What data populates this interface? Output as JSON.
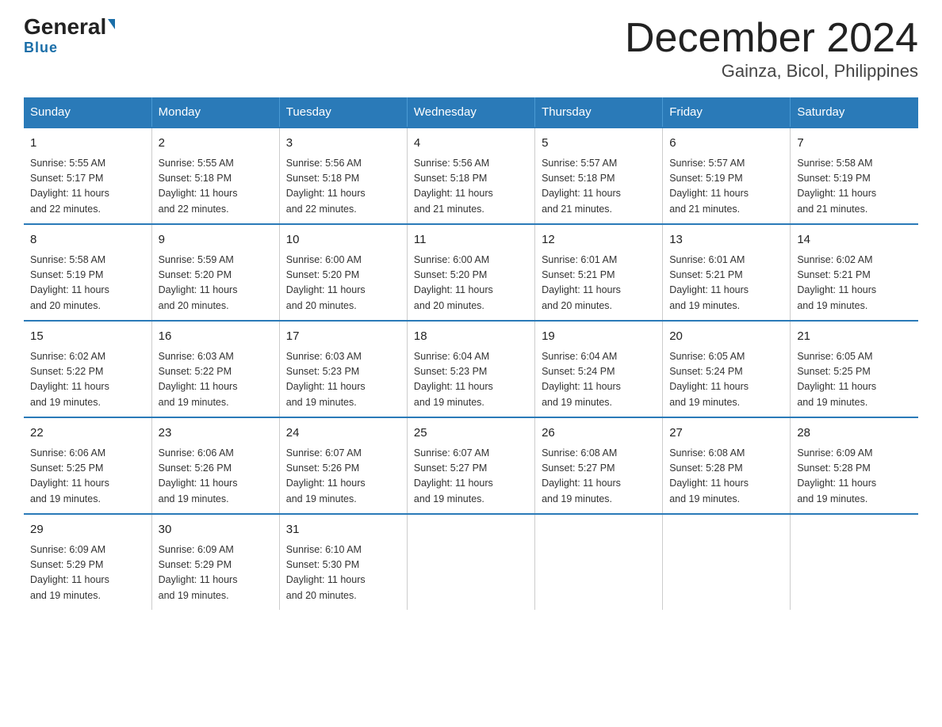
{
  "header": {
    "logo_general": "General",
    "logo_blue": "Blue",
    "title": "December 2024",
    "subtitle": "Gainza, Bicol, Philippines"
  },
  "days_of_week": [
    "Sunday",
    "Monday",
    "Tuesday",
    "Wednesday",
    "Thursday",
    "Friday",
    "Saturday"
  ],
  "weeks": [
    [
      {
        "day": "1",
        "sunrise": "5:55 AM",
        "sunset": "5:17 PM",
        "daylight": "11 hours and 22 minutes."
      },
      {
        "day": "2",
        "sunrise": "5:55 AM",
        "sunset": "5:18 PM",
        "daylight": "11 hours and 22 minutes."
      },
      {
        "day": "3",
        "sunrise": "5:56 AM",
        "sunset": "5:18 PM",
        "daylight": "11 hours and 22 minutes."
      },
      {
        "day": "4",
        "sunrise": "5:56 AM",
        "sunset": "5:18 PM",
        "daylight": "11 hours and 21 minutes."
      },
      {
        "day": "5",
        "sunrise": "5:57 AM",
        "sunset": "5:18 PM",
        "daylight": "11 hours and 21 minutes."
      },
      {
        "day": "6",
        "sunrise": "5:57 AM",
        "sunset": "5:19 PM",
        "daylight": "11 hours and 21 minutes."
      },
      {
        "day": "7",
        "sunrise": "5:58 AM",
        "sunset": "5:19 PM",
        "daylight": "11 hours and 21 minutes."
      }
    ],
    [
      {
        "day": "8",
        "sunrise": "5:58 AM",
        "sunset": "5:19 PM",
        "daylight": "11 hours and 20 minutes."
      },
      {
        "day": "9",
        "sunrise": "5:59 AM",
        "sunset": "5:20 PM",
        "daylight": "11 hours and 20 minutes."
      },
      {
        "day": "10",
        "sunrise": "6:00 AM",
        "sunset": "5:20 PM",
        "daylight": "11 hours and 20 minutes."
      },
      {
        "day": "11",
        "sunrise": "6:00 AM",
        "sunset": "5:20 PM",
        "daylight": "11 hours and 20 minutes."
      },
      {
        "day": "12",
        "sunrise": "6:01 AM",
        "sunset": "5:21 PM",
        "daylight": "11 hours and 20 minutes."
      },
      {
        "day": "13",
        "sunrise": "6:01 AM",
        "sunset": "5:21 PM",
        "daylight": "11 hours and 19 minutes."
      },
      {
        "day": "14",
        "sunrise": "6:02 AM",
        "sunset": "5:21 PM",
        "daylight": "11 hours and 19 minutes."
      }
    ],
    [
      {
        "day": "15",
        "sunrise": "6:02 AM",
        "sunset": "5:22 PM",
        "daylight": "11 hours and 19 minutes."
      },
      {
        "day": "16",
        "sunrise": "6:03 AM",
        "sunset": "5:22 PM",
        "daylight": "11 hours and 19 minutes."
      },
      {
        "day": "17",
        "sunrise": "6:03 AM",
        "sunset": "5:23 PM",
        "daylight": "11 hours and 19 minutes."
      },
      {
        "day": "18",
        "sunrise": "6:04 AM",
        "sunset": "5:23 PM",
        "daylight": "11 hours and 19 minutes."
      },
      {
        "day": "19",
        "sunrise": "6:04 AM",
        "sunset": "5:24 PM",
        "daylight": "11 hours and 19 minutes."
      },
      {
        "day": "20",
        "sunrise": "6:05 AM",
        "sunset": "5:24 PM",
        "daylight": "11 hours and 19 minutes."
      },
      {
        "day": "21",
        "sunrise": "6:05 AM",
        "sunset": "5:25 PM",
        "daylight": "11 hours and 19 minutes."
      }
    ],
    [
      {
        "day": "22",
        "sunrise": "6:06 AM",
        "sunset": "5:25 PM",
        "daylight": "11 hours and 19 minutes."
      },
      {
        "day": "23",
        "sunrise": "6:06 AM",
        "sunset": "5:26 PM",
        "daylight": "11 hours and 19 minutes."
      },
      {
        "day": "24",
        "sunrise": "6:07 AM",
        "sunset": "5:26 PM",
        "daylight": "11 hours and 19 minutes."
      },
      {
        "day": "25",
        "sunrise": "6:07 AM",
        "sunset": "5:27 PM",
        "daylight": "11 hours and 19 minutes."
      },
      {
        "day": "26",
        "sunrise": "6:08 AM",
        "sunset": "5:27 PM",
        "daylight": "11 hours and 19 minutes."
      },
      {
        "day": "27",
        "sunrise": "6:08 AM",
        "sunset": "5:28 PM",
        "daylight": "11 hours and 19 minutes."
      },
      {
        "day": "28",
        "sunrise": "6:09 AM",
        "sunset": "5:28 PM",
        "daylight": "11 hours and 19 minutes."
      }
    ],
    [
      {
        "day": "29",
        "sunrise": "6:09 AM",
        "sunset": "5:29 PM",
        "daylight": "11 hours and 19 minutes."
      },
      {
        "day": "30",
        "sunrise": "6:09 AM",
        "sunset": "5:29 PM",
        "daylight": "11 hours and 19 minutes."
      },
      {
        "day": "31",
        "sunrise": "6:10 AM",
        "sunset": "5:30 PM",
        "daylight": "11 hours and 20 minutes."
      },
      {
        "day": "",
        "sunrise": "",
        "sunset": "",
        "daylight": ""
      },
      {
        "day": "",
        "sunrise": "",
        "sunset": "",
        "daylight": ""
      },
      {
        "day": "",
        "sunrise": "",
        "sunset": "",
        "daylight": ""
      },
      {
        "day": "",
        "sunrise": "",
        "sunset": "",
        "daylight": ""
      }
    ]
  ],
  "labels": {
    "sunrise": "Sunrise:",
    "sunset": "Sunset:",
    "daylight": "Daylight:"
  }
}
